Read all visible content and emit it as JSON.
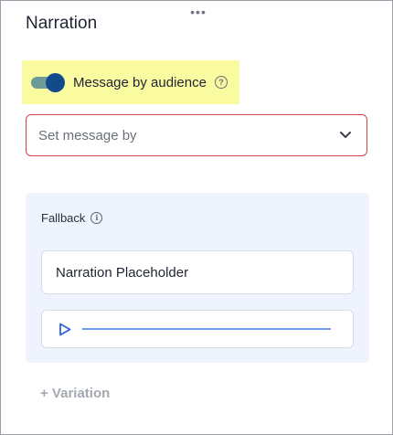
{
  "panel": {
    "handle_glyph": "•••",
    "title": "Narration"
  },
  "audience_toggle": {
    "label": "Message by audience",
    "help_glyph": "?",
    "state": "on",
    "highlight_color": "#fafaa1"
  },
  "message_select": {
    "placeholder": "Set message by",
    "border_color": "#d3434a"
  },
  "fallback": {
    "label": "Fallback",
    "info_glyph": "i",
    "narration_text": "Narration Placeholder",
    "audio": {
      "icon": "play-icon",
      "progress": 0
    }
  },
  "actions": {
    "add_variation": "+ Variation"
  }
}
